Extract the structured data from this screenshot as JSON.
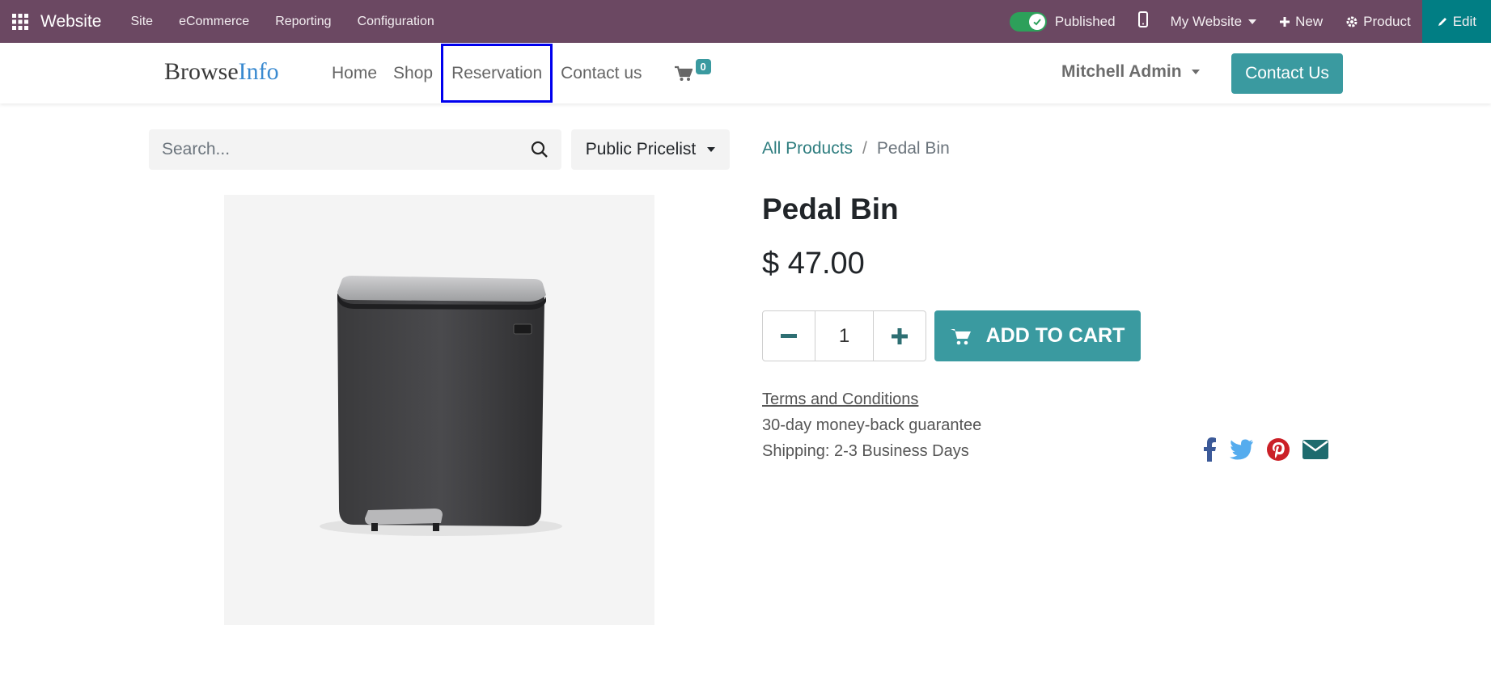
{
  "adminbar": {
    "brand": "Website",
    "menus": [
      "Site",
      "eCommerce",
      "Reporting",
      "Configuration"
    ],
    "published_label": "Published",
    "site_label": "My Website",
    "new_label": "New",
    "product_label": "Product",
    "edit_label": "Edit",
    "color": "#6b4862"
  },
  "header": {
    "logo_part1": "Browse",
    "logo_part2": "Info",
    "nav": [
      "Home",
      "Shop",
      "Reservation",
      "Contact us"
    ],
    "active_nav": "Reservation",
    "cart_count": "0",
    "user": "Mitchell Admin",
    "contact_button": "Contact Us",
    "accent": "#3a9aa0"
  },
  "search": {
    "placeholder": "Search...",
    "pricelist": "Public Pricelist"
  },
  "breadcrumb": {
    "parent": "All Products",
    "separator": "/",
    "current": "Pedal Bin"
  },
  "product": {
    "name": "Pedal Bin",
    "price": "$ 47.00",
    "quantity": "1",
    "add_to_cart": "ADD TO CART",
    "terms": "Terms and Conditions",
    "guarantee": "30-day money-back guarantee",
    "shipping": "Shipping: 2-3 Business Days"
  },
  "social_icons": [
    "facebook-icon",
    "twitter-icon",
    "pinterest-icon",
    "email-icon"
  ]
}
